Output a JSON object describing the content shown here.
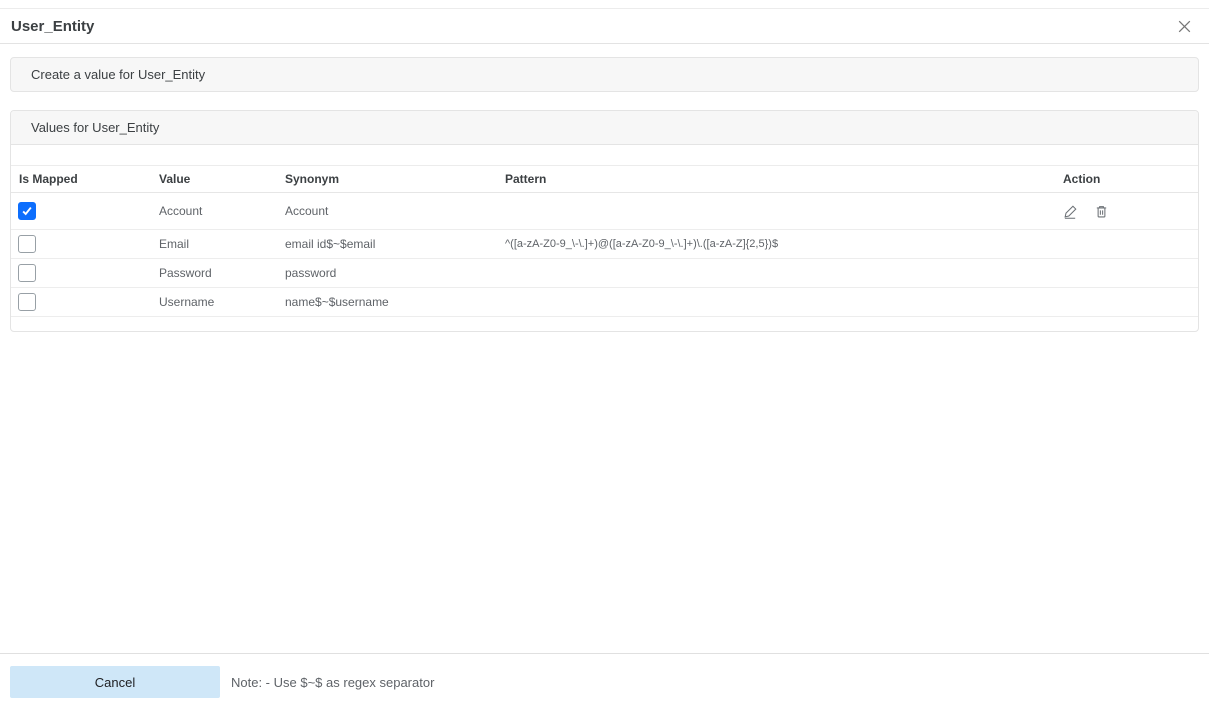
{
  "dialog": {
    "title": "User_Entity"
  },
  "create_panel": {
    "label": "Create a value for User_Entity"
  },
  "values_panel": {
    "label": "Values for User_Entity",
    "table": {
      "columns": [
        "Is Mapped",
        "Value",
        "Synonym",
        "Pattern",
        "Action"
      ],
      "rows": [
        {
          "is_mapped": true,
          "value": "Account",
          "synonym": "Account",
          "pattern": "",
          "has_actions": true
        },
        {
          "is_mapped": false,
          "value": "Email",
          "synonym": "email id$~$email",
          "pattern": "^([a-zA-Z0-9_\\-\\.]+)@([a-zA-Z0-9_\\-\\.]+)\\.([a-zA-Z]{2,5})$",
          "has_actions": false
        },
        {
          "is_mapped": false,
          "value": "Password",
          "synonym": "password",
          "pattern": "",
          "has_actions": false
        },
        {
          "is_mapped": false,
          "value": "Username",
          "synonym": "name$~$username",
          "pattern": "",
          "has_actions": false
        }
      ]
    }
  },
  "footer": {
    "cancel_label": "Cancel",
    "note": "Note: - Use $~$ as regex separator"
  },
  "colors": {
    "checkbox_checked_bg": "#0d6efd",
    "cancel_button_bg": "#cfe7f8",
    "panel_header_bg": "#f7f7f7",
    "border": "#e4e4e4",
    "icon_gray": "#6b7075"
  }
}
